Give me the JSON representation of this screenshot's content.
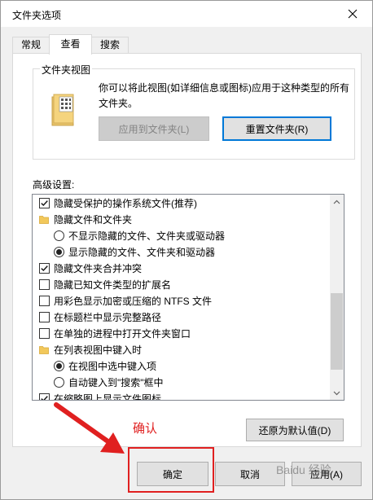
{
  "window": {
    "title": "文件夹选项"
  },
  "tabs": [
    {
      "label": "常规"
    },
    {
      "label": "查看"
    },
    {
      "label": "搜索"
    }
  ],
  "folder_view": {
    "group_label": "文件夹视图",
    "description": "你可以将此视图(如详细信息或图标)应用于这种类型的所有文件夹。",
    "apply_label": "应用到文件夹(L)",
    "reset_label": "重置文件夹(R)"
  },
  "advanced": {
    "label": "高级设置:",
    "items": [
      {
        "type": "checkbox",
        "checked": true,
        "indent": 0,
        "label": "隐藏受保护的操作系统文件(推荐)"
      },
      {
        "type": "folder",
        "indent": 0,
        "label": "隐藏文件和文件夹"
      },
      {
        "type": "radio",
        "checked": false,
        "indent": 1,
        "label": "不显示隐藏的文件、文件夹或驱动器"
      },
      {
        "type": "radio",
        "checked": true,
        "indent": 1,
        "label": "显示隐藏的文件、文件夹和驱动器"
      },
      {
        "type": "checkbox",
        "checked": true,
        "indent": 0,
        "label": "隐藏文件夹合并冲突"
      },
      {
        "type": "checkbox",
        "checked": false,
        "indent": 0,
        "label": "隐藏已知文件类型的扩展名"
      },
      {
        "type": "checkbox",
        "checked": false,
        "indent": 0,
        "label": "用彩色显示加密或压缩的 NTFS 文件"
      },
      {
        "type": "checkbox",
        "checked": false,
        "indent": 0,
        "label": "在标题栏中显示完整路径"
      },
      {
        "type": "checkbox",
        "checked": false,
        "indent": 0,
        "label": "在单独的进程中打开文件夹窗口"
      },
      {
        "type": "folder",
        "indent": 0,
        "label": "在列表视图中键入时"
      },
      {
        "type": "radio",
        "checked": true,
        "indent": 1,
        "label": "在视图中选中键入项"
      },
      {
        "type": "radio",
        "checked": false,
        "indent": 1,
        "label": "自动键入到\"搜索\"框中"
      },
      {
        "type": "checkbox",
        "checked": true,
        "indent": 0,
        "label": "在缩略图上显示文件图标"
      }
    ],
    "restore_label": "还原为默认值(D)"
  },
  "footer": {
    "ok_label": "确定",
    "cancel_label": "取消",
    "apply_label": "应用(A)"
  },
  "annotation": {
    "text": "确认",
    "color": "#e02020"
  },
  "watermark": "Baidu 经验",
  "colors": {
    "accent": "#0078d7",
    "annotation_red": "#e02020"
  }
}
